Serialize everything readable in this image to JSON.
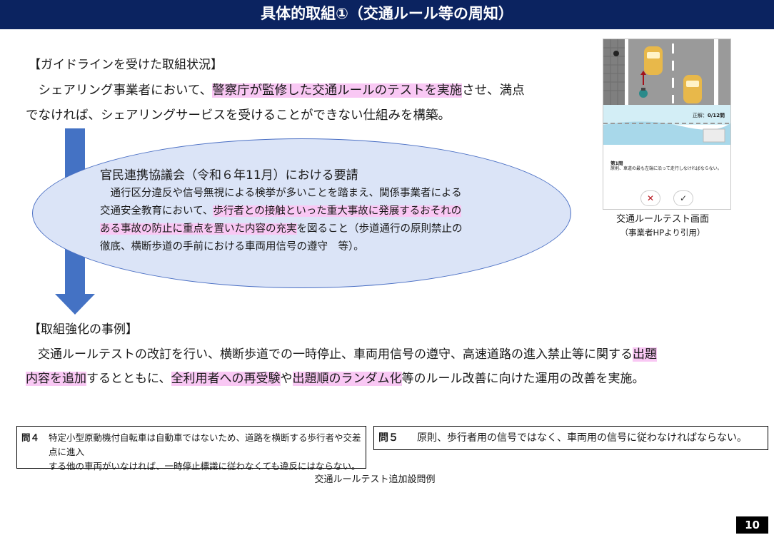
{
  "title": "具体的取組①（交通ルール等の周知）",
  "guideline": {
    "heading": "【ガイドラインを受けた取組状況】",
    "line1_a": "　シェアリング事業者において、",
    "line1_hl": "警察庁が監修した交通ルールのテストを実施",
    "line1_b": "させ、満点",
    "line2": "でなければ、シェアリングサービスを受けることができない仕組みを構築。"
  },
  "request": {
    "heading": "官民連携協議会（令和６年11月）における要請",
    "line1": "　通行区分違反や信号無視による検挙が多いことを踏まえ、関係事業者による",
    "line2_a": "交通安全教育において、",
    "line2_hl": "歩行者との接触といった重大事故に発展するおそれの",
    "line3_hl": "ある事故の防止に重点を置いた内容の充実",
    "line3_b": "を図ること（歩道通行の原則禁止の",
    "line4": "徹底、横断歩道の手前における車両用信号の遵守　等）。"
  },
  "strengthen": {
    "heading": "【取組強化の事例】",
    "line1_a": "　交通ルールテストの改訂を行い、横断歩道での一時停止、車両用信号の遵守、高速道路の進入禁止等に関する",
    "line1_hl": "出題",
    "line2_hl1": "内容を追加",
    "line2_b": "するとともに、",
    "line2_hl2": "全利用者への再受験",
    "line2_c": "や",
    "line2_hl3": "出題順のランダム化",
    "line2_d": "等のルール改善に向けた運用の改善を実施。"
  },
  "app_screen": {
    "score_label": "正解：",
    "score_value": "0/12問",
    "question_title": "第1問",
    "question_text": "原則、車道の最も左端に沿って走行しなければならない。",
    "wrong_icon": "x-icon",
    "right_icon": "check-icon",
    "caption": "交通ルールテスト画面",
    "caption_sub": "（事業者HPより引用）"
  },
  "questions": [
    {
      "num": "問４",
      "text_line1": "特定小型原動機付自転車は自動車ではないため、道路を横断する歩行者や交差点に進入",
      "text_line2": "する他の車両がいなければ、一時停止標識に従わなくても違反にはならない。"
    },
    {
      "num": "問５",
      "text_line1": "原則、歩行者用の信号ではなく、車両用の信号に従わなければならない。"
    }
  ],
  "questions_caption": "交通ルールテスト追加設問例",
  "page_number": "10",
  "colors": {
    "title_bg": "#0b2360",
    "highlight": "#f9c8f4",
    "arrow": "#4472c4",
    "ellipse_fill": "#dbe4f7"
  }
}
